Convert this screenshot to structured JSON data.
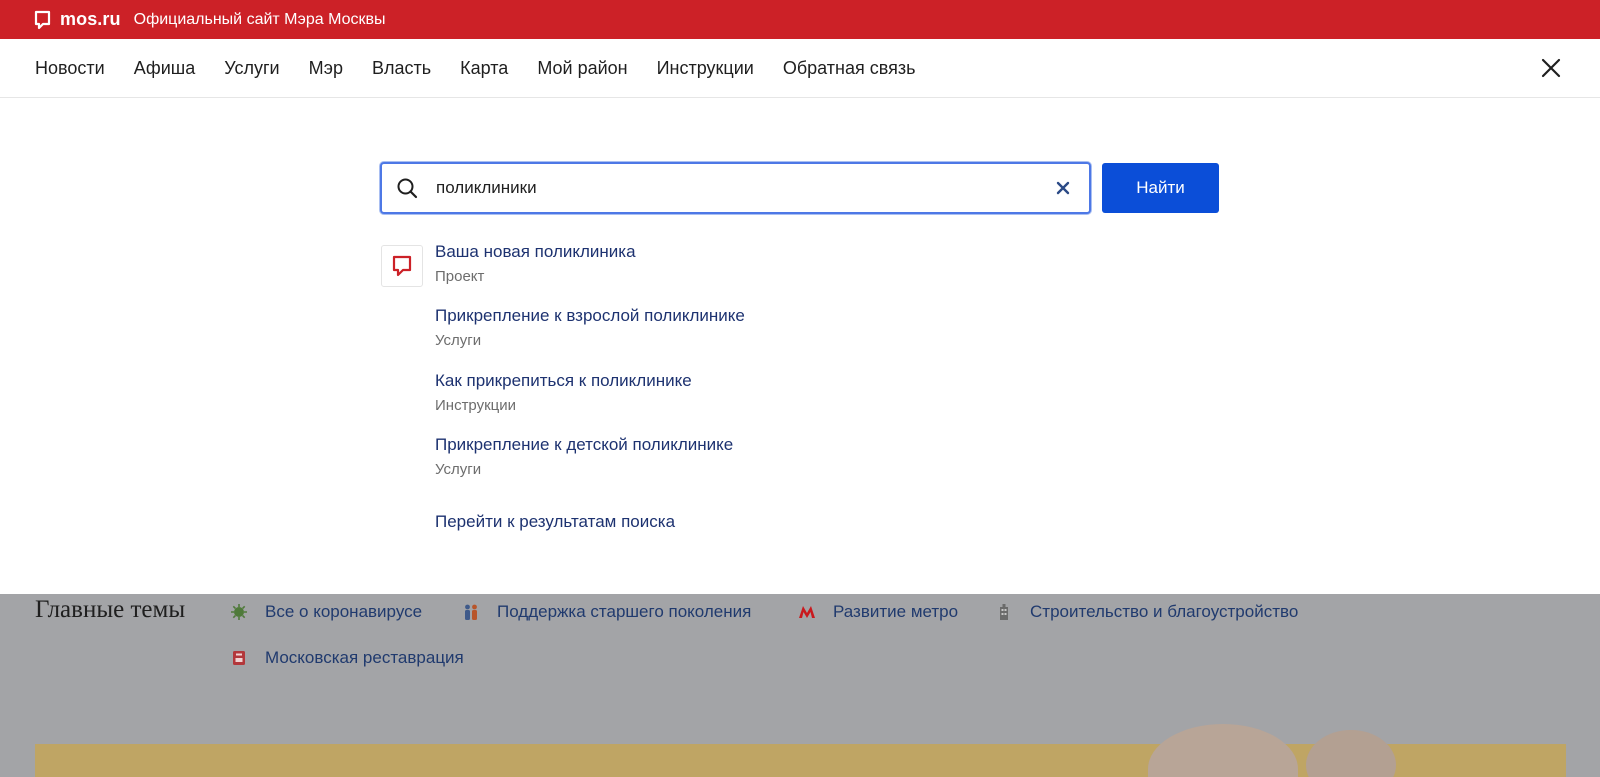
{
  "topbar": {
    "logo_text": "mos.ru",
    "site_title": "Официальный сайт Мэра Москвы",
    "bg_color": "#cc2127"
  },
  "nav": {
    "items": [
      "Новости",
      "Афиша",
      "Услуги",
      "Мэр",
      "Власть",
      "Карта",
      "Мой район",
      "Инструкции",
      "Обратная связь"
    ],
    "close_icon": "close-icon"
  },
  "search": {
    "value": "поликлиники",
    "submit_label": "Найти",
    "submit_color": "#0b4ed8",
    "suggestions": [
      {
        "title": "Ваша новая поликлиника",
        "category": "Проект"
      },
      {
        "title": "Прикрепление к взрослой поликлинике",
        "category": "Услуги"
      },
      {
        "title": "Как прикрепиться к поликлинике",
        "category": "Инструкции"
      },
      {
        "title": "Прикрепление к детской поликлинике",
        "category": "Услуги"
      }
    ],
    "goto_results": "Перейти к результатам поиска"
  },
  "main_topics": {
    "title": "Главные темы",
    "items": [
      {
        "label": "Все о коронавирусе",
        "icon": "virus-icon"
      },
      {
        "label": "Поддержка старшего поколения",
        "icon": "people-icon"
      },
      {
        "label": "Развитие метро",
        "icon": "metro-icon"
      },
      {
        "label": "Строительство и благоустройство",
        "icon": "building-icon"
      },
      {
        "label": "Московская реставрация",
        "icon": "restoration-icon"
      }
    ]
  }
}
